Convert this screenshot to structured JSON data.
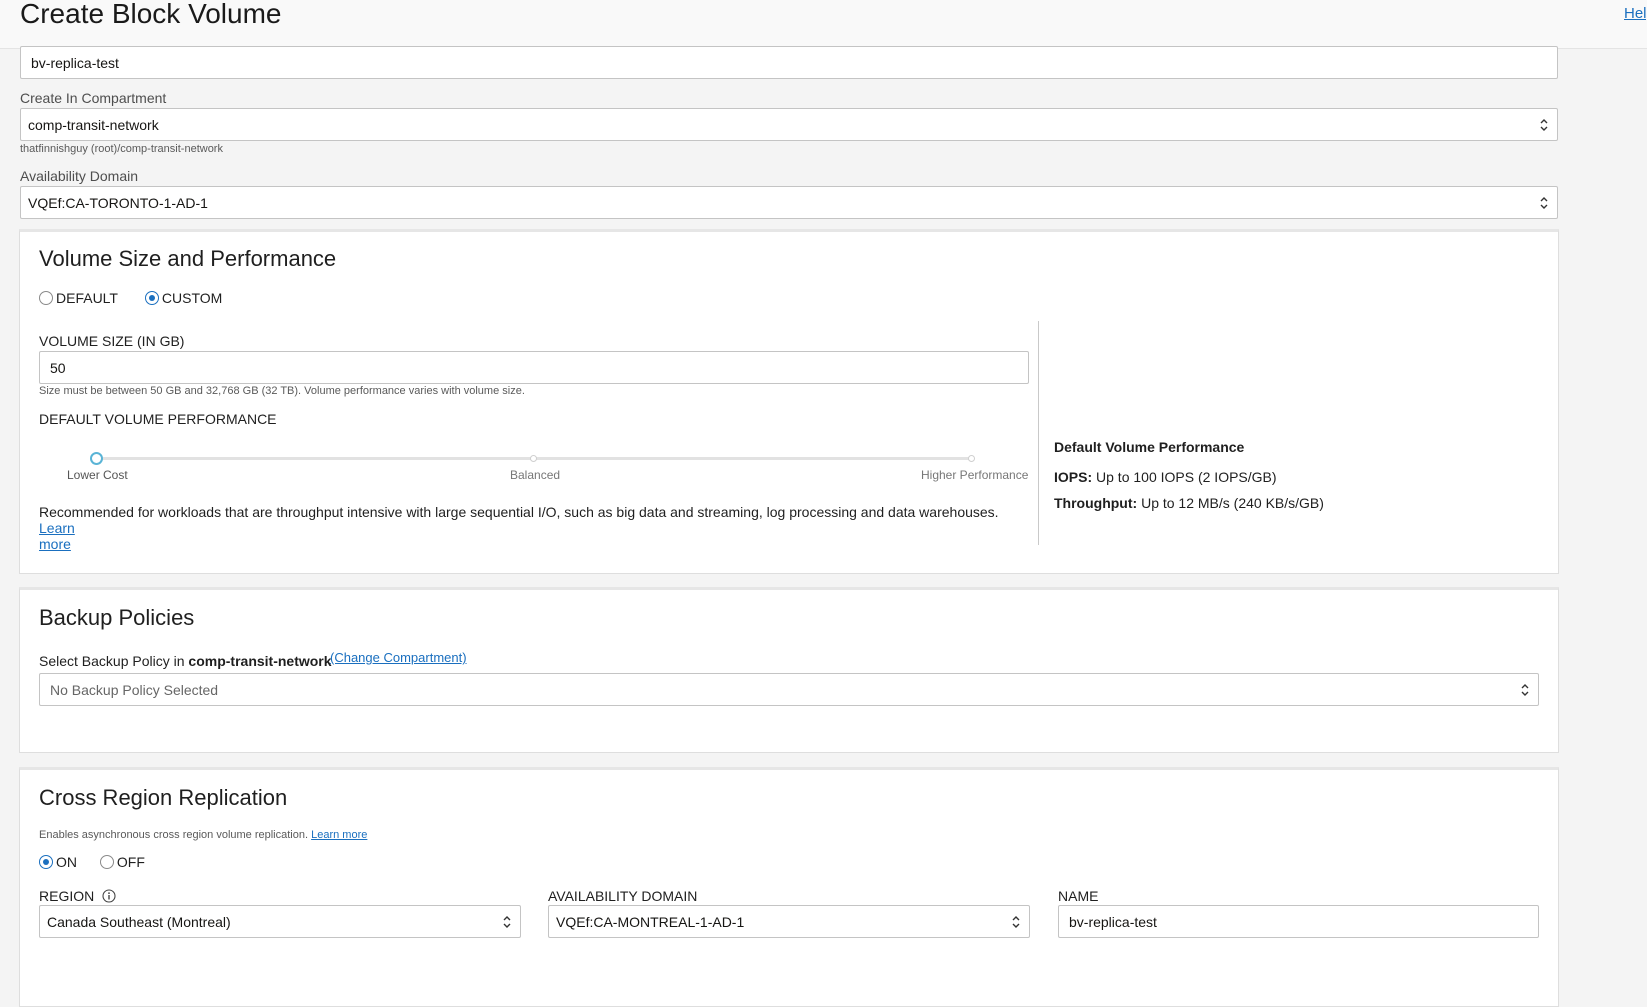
{
  "header": {
    "title": "Create Block Volume",
    "help_label": "Help"
  },
  "form": {
    "name_value": "bv-replica-test",
    "compartment": {
      "label": "Create In Compartment",
      "value": "comp-transit-network",
      "path_hint": "thatfinnishguy (root)/comp-transit-network"
    },
    "availability_domain": {
      "label": "Availability Domain",
      "value": "VQEf:CA-TORONTO-1-AD-1"
    }
  },
  "volume_panel": {
    "title": "Volume Size and Performance",
    "option_default": "DEFAULT",
    "option_custom": "CUSTOM",
    "selected_option": "CUSTOM",
    "size_label": "VOLUME SIZE (IN GB)",
    "size_value": "50",
    "size_hint": "Size must be between 50 GB and 32,768 GB (32 TB). Volume performance varies with volume size.",
    "perf_label": "DEFAULT VOLUME PERFORMANCE",
    "slider": {
      "stops": [
        "Lower Cost",
        "Balanced",
        "Higher Performance"
      ],
      "selected": "Lower Cost"
    },
    "recommendation": "Recommended for workloads that are throughput intensive with large sequential I/O, such as big data and streaming, log processing and data warehouses.",
    "learn_more_1": "Learn",
    "learn_more_2": "more",
    "summary": {
      "title": "Default Volume Performance",
      "iops_label": "IOPS:",
      "iops_value": "Up to 100 IOPS (2 IOPS/GB)",
      "throughput_label": "Throughput:",
      "throughput_value": "Up to 12 MB/s (240 KB/s/GB)"
    }
  },
  "backup_panel": {
    "title": "Backup Policies",
    "select_prefix": "Select Backup Policy in",
    "compartment": "comp-transit-network",
    "change_link": "(Change Compartment)",
    "placeholder": "No Backup Policy Selected"
  },
  "replication_panel": {
    "title": "Cross Region Replication",
    "description": "Enables asynchronous cross region volume replication.",
    "learn_more": "Learn more",
    "option_on": "ON",
    "option_off": "OFF",
    "selected_option": "ON",
    "region_label": "REGION",
    "region_value": "Canada Southeast (Montreal)",
    "ad_label": "AVAILABILITY DOMAIN",
    "ad_value": "VQEf:CA-MONTREAL-1-AD-1",
    "name_label": "NAME",
    "name_value": "bv-replica-test"
  },
  "icons": {
    "select_chevron": "up-down-chevron-icon",
    "info": "info-icon"
  },
  "colors": {
    "accent": "#1a6fbf",
    "slider_thumb": "#5ab4d6"
  }
}
